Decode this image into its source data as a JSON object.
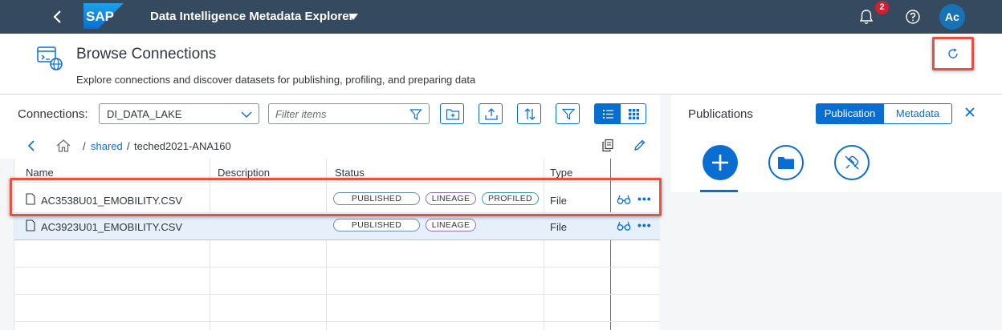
{
  "shell": {
    "logo_text": "SAP",
    "title": "Data Intelligence Metadata Explorer",
    "notification_count": "2",
    "avatar_initials": "Ac"
  },
  "header": {
    "title": "Browse Connections",
    "subtitle": "Explore connections and discover datasets for publishing, profiling, and preparing data"
  },
  "toolbar": {
    "connections_label": "Connections:",
    "connection_value": "DI_DATA_LAKE",
    "filter_placeholder": "Filter items"
  },
  "breadcrumb": {
    "sep1": "/",
    "item1": "shared",
    "sep2": "/",
    "item2": "teched2021-ANA160"
  },
  "table": {
    "columns": [
      "Name",
      "Description",
      "Status",
      "Type"
    ],
    "rows": [
      {
        "name": "AC3538U01_EMOBILITY.CSV",
        "description": "",
        "status": [
          "PUBLISHED",
          "LINEAGE",
          "PROFILED"
        ],
        "type": "File"
      },
      {
        "name": "AC3923U01_EMOBILITY.CSV",
        "description": "",
        "status": [
          "PUBLISHED",
          "LINEAGE"
        ],
        "type": "File"
      }
    ]
  },
  "publications": {
    "title": "Publications",
    "tab_publication": "Publication",
    "tab_metadata": "Metadata"
  },
  "colors": {
    "shell_bg": "#354a5f",
    "accent": "#0a6ed1",
    "highlight": "#e8513f",
    "badge": "#d32030"
  }
}
